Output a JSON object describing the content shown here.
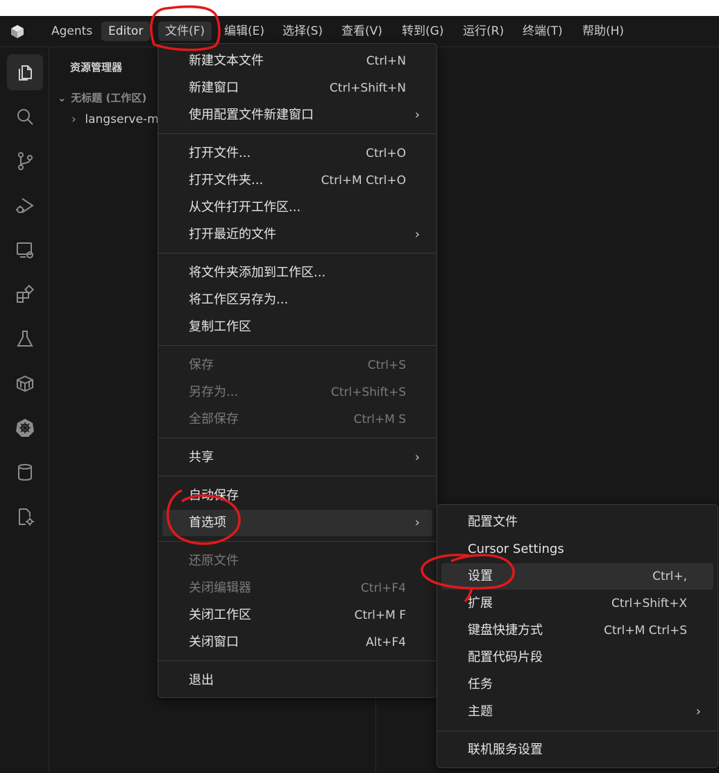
{
  "menubar": {
    "items": [
      {
        "label": "Agents"
      },
      {
        "label": "Editor"
      },
      {
        "label": "文件(F)"
      },
      {
        "label": "编辑(E)"
      },
      {
        "label": "选择(S)"
      },
      {
        "label": "查看(V)"
      },
      {
        "label": "转到(G)"
      },
      {
        "label": "运行(R)"
      },
      {
        "label": "终端(T)"
      },
      {
        "label": "帮助(H)"
      }
    ]
  },
  "sidebar": {
    "title": "资源管理器",
    "workspace": "无标题 (工作区)",
    "folder": "langserve-m"
  },
  "file_menu": {
    "items": [
      {
        "label": "新建文本文件",
        "shortcut": "Ctrl+N"
      },
      {
        "label": "新建窗口",
        "shortcut": "Ctrl+Shift+N"
      },
      {
        "label": "使用配置文件新建窗口",
        "shortcut": ""
      },
      {
        "label": "打开文件...",
        "shortcut": "Ctrl+O"
      },
      {
        "label": "打开文件夹...",
        "shortcut": "Ctrl+M Ctrl+O"
      },
      {
        "label": "从文件打开工作区...",
        "shortcut": ""
      },
      {
        "label": "打开最近的文件",
        "shortcut": ""
      },
      {
        "label": "将文件夹添加到工作区...",
        "shortcut": ""
      },
      {
        "label": "将工作区另存为...",
        "shortcut": ""
      },
      {
        "label": "复制工作区",
        "shortcut": ""
      },
      {
        "label": "保存",
        "shortcut": "Ctrl+S"
      },
      {
        "label": "另存为...",
        "shortcut": "Ctrl+Shift+S"
      },
      {
        "label": "全部保存",
        "shortcut": "Ctrl+M S"
      },
      {
        "label": "共享",
        "shortcut": ""
      },
      {
        "label": "自动保存",
        "shortcut": ""
      },
      {
        "label": "首选项",
        "shortcut": ""
      },
      {
        "label": "还原文件",
        "shortcut": ""
      },
      {
        "label": "关闭编辑器",
        "shortcut": "Ctrl+F4"
      },
      {
        "label": "关闭工作区",
        "shortcut": "Ctrl+M F"
      },
      {
        "label": "关闭窗口",
        "shortcut": "Alt+F4"
      },
      {
        "label": "退出",
        "shortcut": ""
      }
    ],
    "submenu_arrow": "›"
  },
  "preferences_menu": {
    "items": [
      {
        "label": "配置文件",
        "shortcut": ""
      },
      {
        "label": "Cursor Settings",
        "shortcut": ""
      },
      {
        "label": "设置",
        "shortcut": "Ctrl+,"
      },
      {
        "label": "扩展",
        "shortcut": "Ctrl+Shift+X"
      },
      {
        "label": "键盘快捷方式",
        "shortcut": "Ctrl+M Ctrl+S"
      },
      {
        "label": "配置代码片段",
        "shortcut": ""
      },
      {
        "label": "任务",
        "shortcut": ""
      },
      {
        "label": "主题",
        "shortcut": ""
      },
      {
        "label": "联机服务设置",
        "shortcut": ""
      }
    ]
  },
  "colors": {
    "background": "#181818",
    "menu_bg": "#1f1f1f",
    "hover": "#2f2f2f",
    "annotation": "#e0191b"
  },
  "icons": [
    "app-logo-icon",
    "explorer-icon",
    "search-icon",
    "source-control-icon",
    "run-debug-icon",
    "remote-explorer-icon",
    "extensions-icon",
    "testing-icon",
    "containers-icon",
    "kubernetes-icon",
    "database-icon",
    "code-settings-icon"
  ]
}
